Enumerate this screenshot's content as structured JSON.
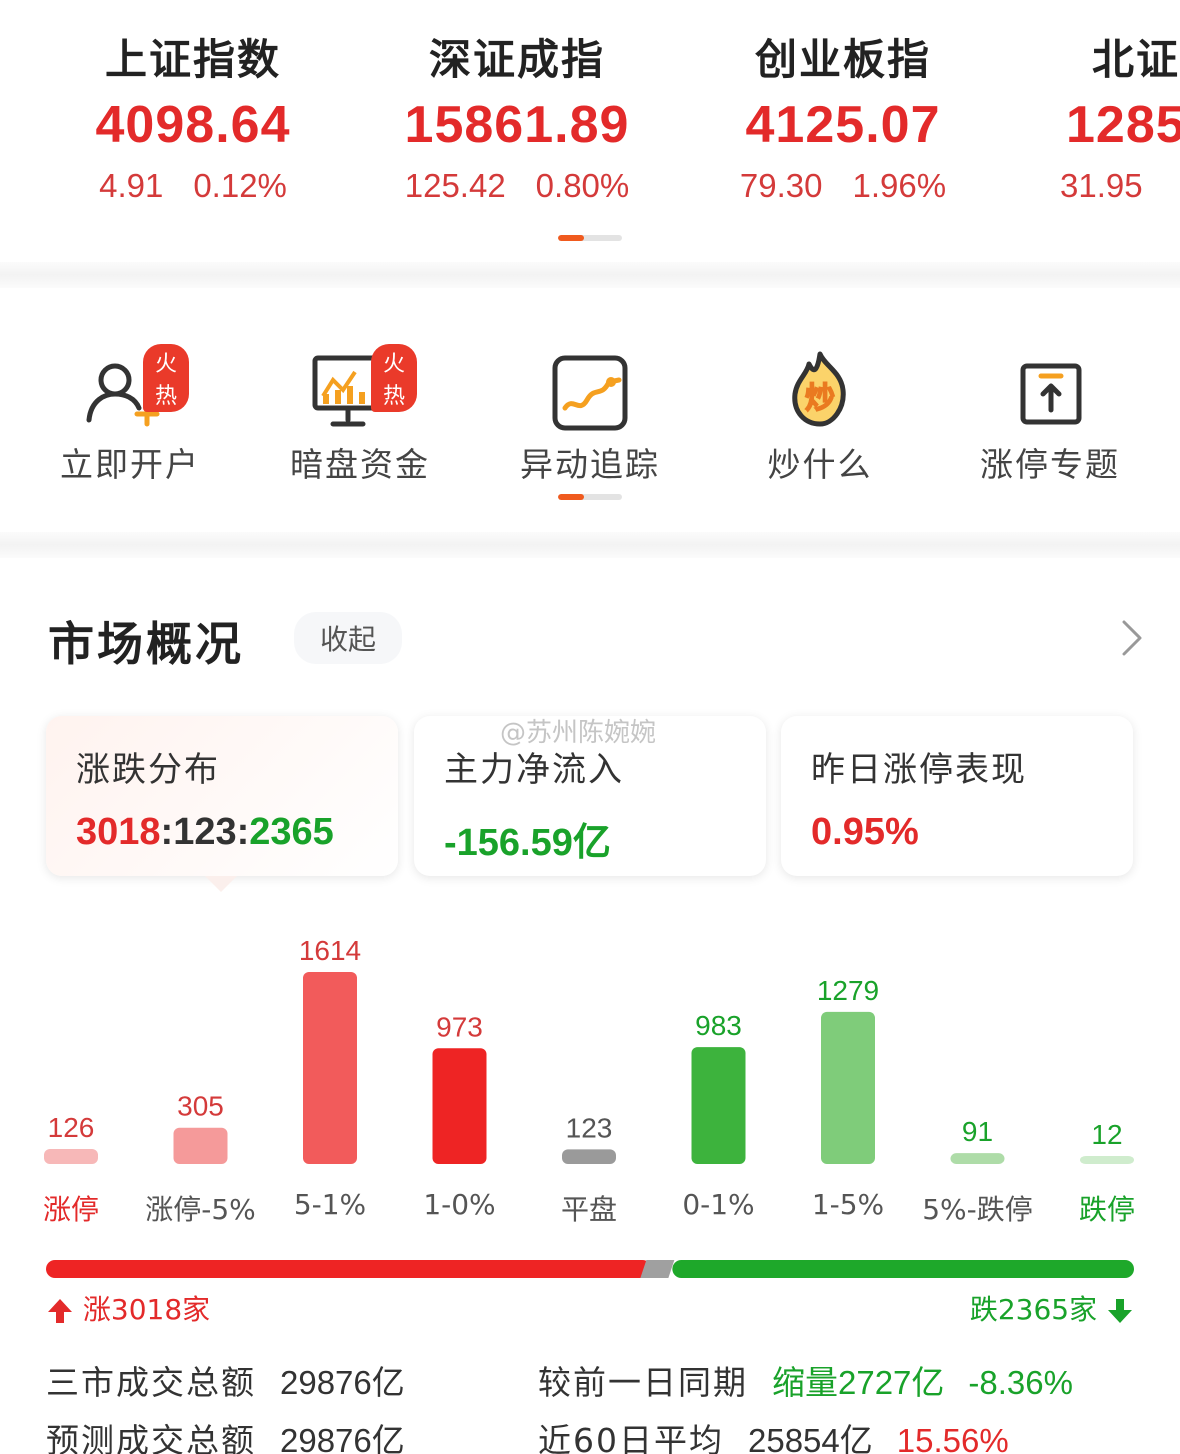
{
  "indices": [
    {
      "name": "上证指数",
      "value": "4098.64",
      "change": "4.91",
      "pct": "0.12%"
    },
    {
      "name": "深证成指",
      "value": "15861.89",
      "change": "125.42",
      "pct": "0.80%"
    },
    {
      "name": "创业板指",
      "value": "4125.07",
      "change": "79.30",
      "pct": "1.96%"
    },
    {
      "name": "北证",
      "value": "1285",
      "change": "31.95",
      "pct": ""
    }
  ],
  "shortcuts": [
    {
      "label": "立即开户",
      "badge": "火热",
      "icon": "user-add-icon"
    },
    {
      "label": "暗盘资金",
      "badge": "火热",
      "icon": "monitor-chart-icon"
    },
    {
      "label": "异动追踪",
      "badge": "",
      "icon": "trend-line-icon"
    },
    {
      "label": "炒什么",
      "badge": "",
      "icon": "fire-icon",
      "icon_text": "炒"
    },
    {
      "label": "涨停专题",
      "badge": "",
      "icon": "up-arrow-box-icon"
    }
  ],
  "market": {
    "title": "市场概况",
    "collapse_label": "收起",
    "watermark": "@苏州陈婉婉",
    "cards": [
      {
        "title": "涨跌分布",
        "up": "3018",
        "sep1": ":",
        "flat": "123",
        "sep2": ":",
        "down": "2365"
      },
      {
        "title": "主力净流入",
        "value": "-156.59亿"
      },
      {
        "title": "昨日涨停表现",
        "value": "0.95%"
      }
    ]
  },
  "chart_data": {
    "type": "bar",
    "categories": [
      "涨停",
      "涨停-5%",
      "5-1%",
      "1-0%",
      "平盘",
      "0-1%",
      "1-5%",
      "5%-跌停",
      "跌停"
    ],
    "values": [
      126,
      305,
      1614,
      973,
      123,
      983,
      1279,
      91,
      12
    ],
    "colors": [
      "#f7b8b8",
      "#f59a9a",
      "#f25b5b",
      "#ee2424",
      "#9a9a9a",
      "#3db33d",
      "#7fcc7a",
      "#aedca8",
      "#cfeccd"
    ],
    "label_colors": [
      "#d43a3a",
      "#d43a3a",
      "#d43a3a",
      "#d43a3a",
      "#555555",
      "#19a22a",
      "#19a22a",
      "#19a22a",
      "#19a22a"
    ],
    "ylim": [
      0,
      1614
    ]
  },
  "breadth": {
    "up_label": "涨3018家",
    "down_label": "跌2365家",
    "up": 3018,
    "flat": 123,
    "down": 2365
  },
  "stats": {
    "total_label": "三市成交总额",
    "total_value": "29876亿",
    "forecast_label": "预测成交总额",
    "forecast_value": "29876亿",
    "compare_label": "较前一日同期",
    "compare_value": "缩量2727亿",
    "compare_pct": "-8.36%",
    "avg_label": "近60日平均",
    "avg_value": "25854亿",
    "avg_pct": "15.56%"
  },
  "colors": {
    "up": "#e32a2a",
    "down": "#19a22a",
    "accent": "#f05a1e"
  }
}
